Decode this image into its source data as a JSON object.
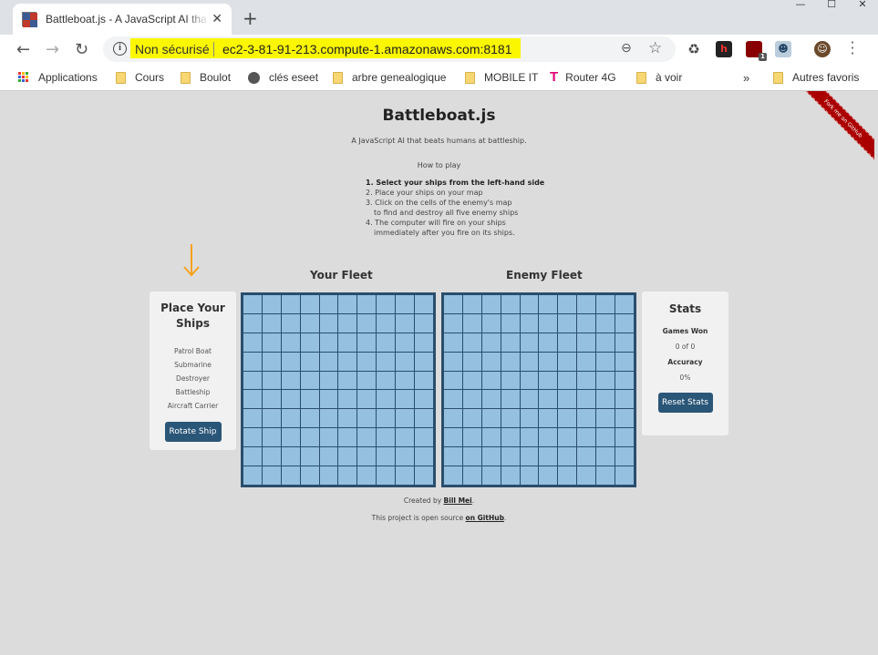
{
  "browser": {
    "tab_title": "Battleboat.js - A JavaScript AI tha",
    "tab_close": "✕",
    "new_tab": "+",
    "win_controls": [
      "—",
      "☐",
      "✕"
    ],
    "nav": {
      "back": "←",
      "forward": "→",
      "reload": "↻"
    },
    "security_label": "Non sécurisé",
    "url": "ec2-3-81-91-213.compute-1.amazonaws.com:8181",
    "extension_badge": "1",
    "bookmarks": [
      {
        "label": "Applications",
        "icon": "apps-grid-icon"
      },
      {
        "label": "Cours",
        "icon": "folder-icon"
      },
      {
        "label": "Boulot",
        "icon": "folder-icon"
      },
      {
        "label": "clés eseet",
        "icon": "globe-icon"
      },
      {
        "label": "arbre genealogique",
        "icon": "folder-icon"
      },
      {
        "label": "MOBILE IT",
        "icon": "folder-icon"
      },
      {
        "label": "Router 4G",
        "icon": "t-mobile-icon"
      },
      {
        "label": "à voir",
        "icon": "folder-icon"
      }
    ],
    "bookmarks_overflow": "»",
    "other_bookmarks": "Autres favoris"
  },
  "page": {
    "title": "Battleboat.js",
    "tagline": "A JavaScript AI that beats humans at battleship.",
    "how_to_play": "How to play",
    "steps": [
      "1. Select your ships from the left-hand side",
      "2. Place your ships on your map",
      "3. Click on the cells of the enemy's map",
      "to find and destroy all five enemy ships",
      "4. The computer will fire on your ships",
      "immediately after you fire on its ships."
    ],
    "ribbon": "Fork me on GitHub",
    "your_fleet": "Your Fleet",
    "enemy_fleet": "Enemy Fleet",
    "place_title": "Place Your Ships",
    "ships": [
      "Patrol Boat",
      "Submarine",
      "Destroyer",
      "Battleship",
      "Aircraft Carrier"
    ],
    "rotate_button": "Rotate Ship",
    "stats_title": "Stats",
    "games_won_label": "Games Won",
    "games_won_value": "0 of 0",
    "accuracy_label": "Accuracy",
    "accuracy_value": "0%",
    "reset_button": "Reset Stats",
    "footer_created": "Created by ",
    "footer_author": "Bill Mei",
    "footer_created_end": ".",
    "footer_open": "This project is open source ",
    "footer_github": "on GitHub",
    "footer_open_end": "."
  },
  "colors": {
    "accent_button": "#2a5678",
    "grid_cell": "#95c0e0",
    "grid_border": "#2a4e6c",
    "highlight": "#fbf700",
    "arrow": "#f7a21b",
    "ribbon": "#aa0000"
  }
}
